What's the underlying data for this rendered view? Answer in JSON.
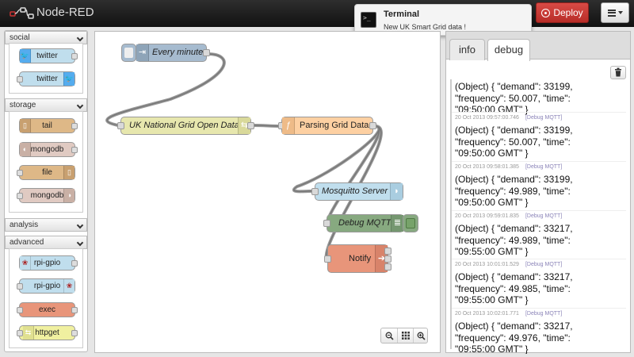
{
  "app": {
    "title": "Node-RED",
    "deploy_label": "Deploy",
    "accent": "#c9302c"
  },
  "notification": {
    "title": "Terminal",
    "text": "New UK Smart Grid data !"
  },
  "palette": {
    "categories": [
      {
        "label": "social",
        "nodes": [
          {
            "label": "twitter",
            "color": "#c0deed"
          },
          {
            "label": "twitter",
            "color": "#c0deed"
          }
        ]
      },
      {
        "label": "storage",
        "nodes": [
          {
            "label": "tail",
            "color": "#deb887"
          },
          {
            "label": "mongodb",
            "color": "#e0cac2"
          },
          {
            "label": "file",
            "color": "#deb887"
          },
          {
            "label": "mongodb",
            "color": "#e0cac2"
          }
        ]
      },
      {
        "label": "analysis",
        "nodes": []
      },
      {
        "label": "advanced",
        "nodes": [
          {
            "label": "rpi-gpio",
            "color": "#c0deed"
          },
          {
            "label": "rpi-gpio",
            "color": "#c0deed"
          },
          {
            "label": "exec",
            "color": "#e8957a"
          },
          {
            "label": "httpget",
            "color": "#f0f0a0"
          }
        ]
      }
    ]
  },
  "flow": {
    "nodes": [
      {
        "label": "Every minute",
        "color": "#a6bbcf"
      },
      {
        "label": "UK National Grid Open Data",
        "color": "#e7e7ae"
      },
      {
        "label": "Parsing Grid Data",
        "color": "#fdd0a2"
      },
      {
        "label": "Mosquitto Server",
        "color": "#c0deed"
      },
      {
        "label": "Debug MQTT",
        "color": "#87a980"
      },
      {
        "label": "Notify",
        "color": "#e8957a"
      }
    ]
  },
  "sidebar": {
    "tabs": [
      {
        "label": "info"
      },
      {
        "label": "debug"
      }
    ],
    "messages": [
      {
        "meta": "",
        "source": "",
        "lines": [
          "(Object) { \"demand\": 33199,",
          "\"frequency\": 50.007, \"time\":",
          "\"09:50:00 GMT\" }"
        ]
      },
      {
        "meta": "20 Oct 2013 09:57:00.746",
        "source": "[Debug MQTT]",
        "lines": [
          "(Object) { \"demand\": 33199,",
          "\"frequency\": 50.007, \"time\":",
          "\"09:50:00 GMT\" }"
        ]
      },
      {
        "meta": "20 Oct 2013 09:58:01.385",
        "source": "[Debug MQTT]",
        "lines": [
          "(Object) { \"demand\": 33199,",
          "\"frequency\": 49.989, \"time\":",
          "\"09:50:00 GMT\" }"
        ]
      },
      {
        "meta": "20 Oct 2013 09:59:01.835",
        "source": "[Debug MQTT]",
        "lines": [
          "(Object) { \"demand\": 33217,",
          "\"frequency\": 49.989, \"time\":",
          "\"09:55:00 GMT\" }"
        ]
      },
      {
        "meta": "20 Oct 2013 10:01:01.529",
        "source": "[Debug MQTT]",
        "lines": [
          "(Object) { \"demand\": 33217,",
          "\"frequency\": 49.985, \"time\":",
          "\"09:55:00 GMT\" }"
        ]
      },
      {
        "meta": "20 Oct 2013 10:02:01.771",
        "source": "[Debug MQTT]",
        "lines": [
          "(Object) { \"demand\": 33217,",
          "\"frequency\": 49.976, \"time\":",
          "\"09:55:00 GMT\" }"
        ]
      }
    ]
  }
}
